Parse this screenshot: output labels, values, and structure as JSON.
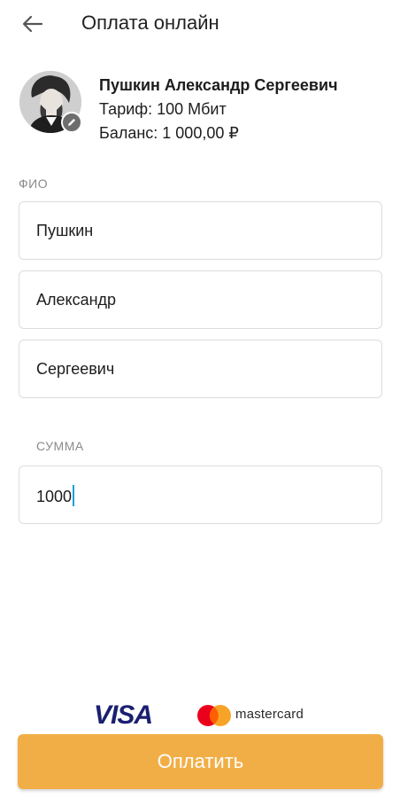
{
  "header": {
    "title": "Оплата онлайн"
  },
  "profile": {
    "name": "Пушкин Александр Сергеевич",
    "tariff": "Тариф: 100 Мбит",
    "balance": "Баланс: 1 000,00 ₽"
  },
  "form": {
    "fio_label": "ФИО",
    "last_name": "Пушкин",
    "first_name": "Александр",
    "middle_name": "Сергеевич",
    "sum_label": "СУММА",
    "sum_value": "1000"
  },
  "payment": {
    "visa_label": "VISA",
    "mastercard_label": "mastercard",
    "pay_button": "Оплатить"
  },
  "colors": {
    "accent": "#f2ae46",
    "visa_blue": "#1a1f71",
    "mc_red": "#eb001b",
    "mc_orange": "#f79e1b",
    "caret": "#1aa0d8"
  }
}
